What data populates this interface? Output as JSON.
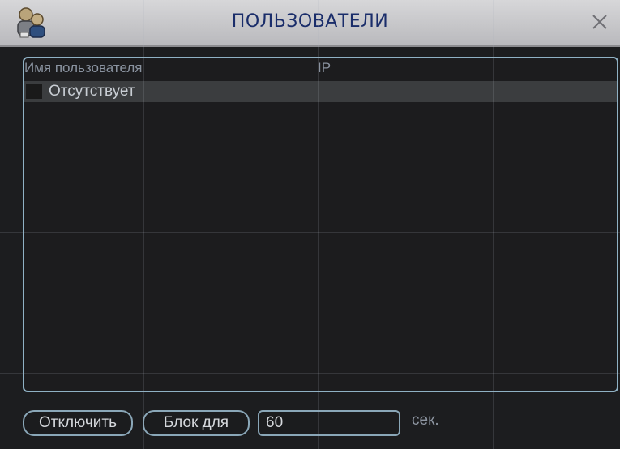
{
  "window": {
    "title": "ПОЛЬЗОВАТЕЛИ"
  },
  "table": {
    "columns": [
      "Имя пользователя",
      "IP"
    ],
    "rows": [
      {
        "name": "Отсутствует",
        "ip": ""
      }
    ]
  },
  "controls": {
    "disconnect_label": "Отключить",
    "block_label": "Блок для",
    "block_seconds": "60",
    "unit_label": "сек."
  },
  "icons": {
    "title_icon": "users-icon",
    "close": "close-icon"
  },
  "colors": {
    "title_text": "#1a2d6a",
    "panel_border": "#8fb1c4",
    "background": "#1c1d1f"
  }
}
